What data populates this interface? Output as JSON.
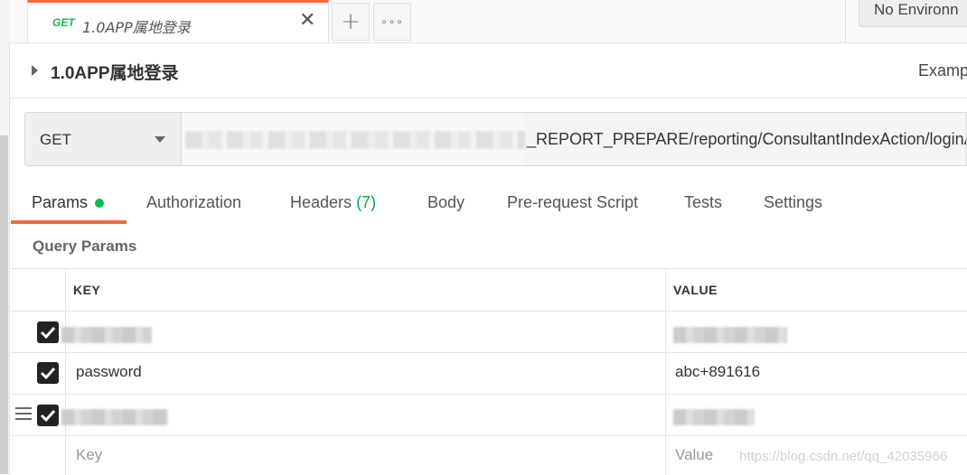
{
  "tab": {
    "method": "GET",
    "title": "1.0APP属地登录",
    "close": "✕",
    "add": "+",
    "more": "∘∘∘"
  },
  "env": {
    "label": "No Environn"
  },
  "request": {
    "name": "1.0APP属地登录",
    "examples_label": "Examp"
  },
  "url_bar": {
    "method": "GET",
    "url_visible": "_REPORT_PREPARE/reporting/ConsultantIndexAction/loginA"
  },
  "subtabs": [
    {
      "label": "Params"
    },
    {
      "label": "Authorization"
    },
    {
      "label": "Headers",
      "count": "(7)"
    },
    {
      "label": "Body"
    },
    {
      "label": "Pre-request Script"
    },
    {
      "label": "Tests"
    },
    {
      "label": "Settings"
    }
  ],
  "query_params": {
    "title": "Query Params",
    "headers": {
      "key": "KEY",
      "value": "VALUE"
    },
    "rows": [
      {
        "key": "",
        "value": "",
        "checked": true
      },
      {
        "key": "password",
        "value": "abc+891616",
        "checked": true
      },
      {
        "key": "",
        "value": "",
        "checked": true
      }
    ],
    "placeholder": {
      "key": "Key",
      "value": "Value"
    }
  },
  "watermark": "https://blog.csdn.net/qq_42035966",
  "colors": {
    "accent": "#f26b3a",
    "get": "#0cbb52"
  }
}
